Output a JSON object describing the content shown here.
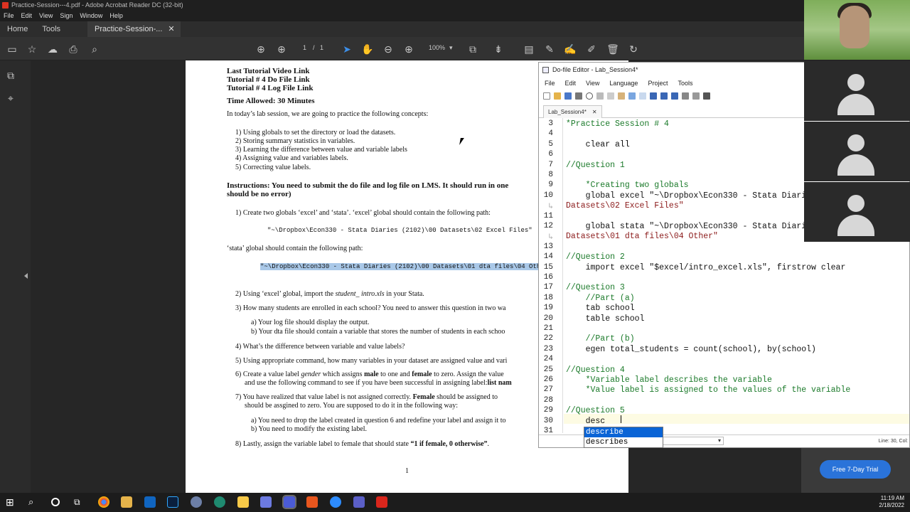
{
  "window": {
    "title": "Practice-Session---4.pdf - Adobe Acrobat Reader DC (32-bit)"
  },
  "menubar": [
    "File",
    "Edit",
    "View",
    "Sign",
    "Window",
    "Help"
  ],
  "tabs": {
    "home": "Home",
    "tools": "Tools",
    "doc": "Practice-Session-..."
  },
  "toolbar": {
    "page_current": "1",
    "page_sep": "/",
    "page_total": "1",
    "zoom": "100%"
  },
  "pdf": {
    "links": [
      "Last Tutorial Video Link",
      "Tutorial # 4 Do File Link",
      "Tutorial # 4 Log File Link"
    ],
    "time_allowed": "Time Allowed: 30 Minutes",
    "intro": "In today’s lab session, we are going to practice the following concepts:",
    "concepts": [
      "1)  Using globals to set the directory or load the datasets.",
      "2)  Storing summary statistics in variables.",
      "3)  Learning the difference between value and variable labels",
      "4)  Assigning value and variables labels.",
      "5)  Correcting value labels."
    ],
    "instructions_1": "Instructions: You need to submit the do file and log file on LMS. It should run in one",
    "instructions_2": "should be no error)",
    "q1": "1)  Create two globals ‘excel’ and ‘stata’. ‘excel’ global should contain the following path:",
    "q1_path": "\"~\\Dropbox\\Econ330 - Stata Diaries (2102)\\00 Datasets\\02 Excel Files\"",
    "q1_stata": "‘stata’ global should contain the following path:",
    "q1_path2": "\"~\\Dropbox\\Econ330 - Stata Diaries (2102)\\00 Datasets\\01 dta files\\04 Oth",
    "q2_a": "2)  Using ‘excel’ global, import the",
    "q2_file": "student_ intro.xls",
    "q2_b": "in your Stata.",
    "q3": "3)  How many students are enrolled in each school? You need to answer this question in two wa",
    "q3a": "a)  Your log file should display the output.",
    "q3b": "b)  Your dta file should contain a variable that stores the number of students in each schoo",
    "q4": "4)  What’s the difference between variable and value labels?",
    "q5": "5)  Using appropriate command, how many variables in your dataset are assigned value and vari",
    "q6_1a": "6)  Create a value label",
    "q6_1b": "gender",
    "q6_1c": "which assigns",
    "q6_1d": "male",
    "q6_1e": "to one and",
    "q6_1f": "female",
    "q6_1g": "to zero. Assign the value",
    "q6_2": "and use the following command to see if you have been successful in assigning label:",
    "q6_2b": "list nam",
    "q7_1a": "7)  You have realized that value label is not assigned correctly.",
    "q7_1b": "Female",
    "q7_1c": "should be assigned to",
    "q7_2": "should be assgined to zero. You are supposed to do it in the following way:",
    "q7a": "a)  You need to drop the label created in question 6 and redefine your label and assign it to",
    "q7b": "b)  You need to modify the existing label.",
    "q8_a": "8)  Lastly, assign the variable label to female that should state",
    "q8_b": "“1 if female, 0 otherwise”",
    "q8_c": ".",
    "page_number": "1"
  },
  "dofile": {
    "title": "Do-file Editor - Lab_Session4*",
    "menu": [
      "File",
      "Edit",
      "View",
      "Language",
      "Project",
      "Tools"
    ],
    "tab": "Lab_Session4*",
    "status": "Line: 30, Col:",
    "lines": [
      {
        "n": "3",
        "text": "*Practice Session # 4",
        "cls": "cm"
      },
      {
        "n": "4",
        "text": "",
        "cls": ""
      },
      {
        "n": "5",
        "text": "    clear all",
        "cls": "kw"
      },
      {
        "n": "6",
        "text": "",
        "cls": ""
      },
      {
        "n": "7",
        "text": "//Question 1",
        "cls": "cm"
      },
      {
        "n": "8",
        "text": "",
        "cls": ""
      },
      {
        "n": "9",
        "text": "    *Creating two globals",
        "cls": "cm"
      },
      {
        "n": "10",
        "text": "    global excel \"~\\Dropbox\\Econ330 - Stata Diari",
        "cls": "kw"
      },
      {
        "n": "",
        "text": "Datasets\\02 Excel Files\"",
        "cls": "str"
      },
      {
        "n": "11",
        "text": "",
        "cls": ""
      },
      {
        "n": "12",
        "text": "    global stata \"~\\Dropbox\\Econ330 - Stata Diari",
        "cls": "kw"
      },
      {
        "n": "",
        "text": "Datasets\\01 dta files\\04 Other\"",
        "cls": "str"
      },
      {
        "n": "13",
        "text": "",
        "cls": ""
      },
      {
        "n": "14",
        "text": "//Question 2",
        "cls": "cm"
      },
      {
        "n": "15",
        "text": "    import excel \"$excel/intro_excel.xls\", firstrow clear",
        "cls": "kw"
      },
      {
        "n": "16",
        "text": "",
        "cls": ""
      },
      {
        "n": "17",
        "text": "//Question 3",
        "cls": "cm"
      },
      {
        "n": "18",
        "text": "    //Part (a)",
        "cls": "cm"
      },
      {
        "n": "19",
        "text": "    tab school",
        "cls": "kw"
      },
      {
        "n": "20",
        "text": "    table school",
        "cls": "kw"
      },
      {
        "n": "21",
        "text": "",
        "cls": ""
      },
      {
        "n": "22",
        "text": "    //Part (b)",
        "cls": "cm"
      },
      {
        "n": "23",
        "text": "    egen total_students = count(school), by(school)",
        "cls": "kw"
      },
      {
        "n": "24",
        "text": "",
        "cls": ""
      },
      {
        "n": "25",
        "text": "//Question 4",
        "cls": "cm"
      },
      {
        "n": "26",
        "text": "    *Variable label describes the variable",
        "cls": "cm"
      },
      {
        "n": "27",
        "text": "    *Value label is assigned to the values of the variable",
        "cls": "cm"
      },
      {
        "n": "28",
        "text": "",
        "cls": ""
      },
      {
        "n": "29",
        "text": "//Question 5",
        "cls": "cm"
      },
      {
        "n": "30",
        "text": "    desc",
        "cls": "kw"
      },
      {
        "n": "31",
        "text": "",
        "cls": ""
      }
    ],
    "autocomplete": [
      "describe",
      "describes"
    ]
  },
  "trial_button": "Free 7-Day Trial",
  "clock": {
    "time": "11:19 AM",
    "date": "2/18/2022"
  }
}
